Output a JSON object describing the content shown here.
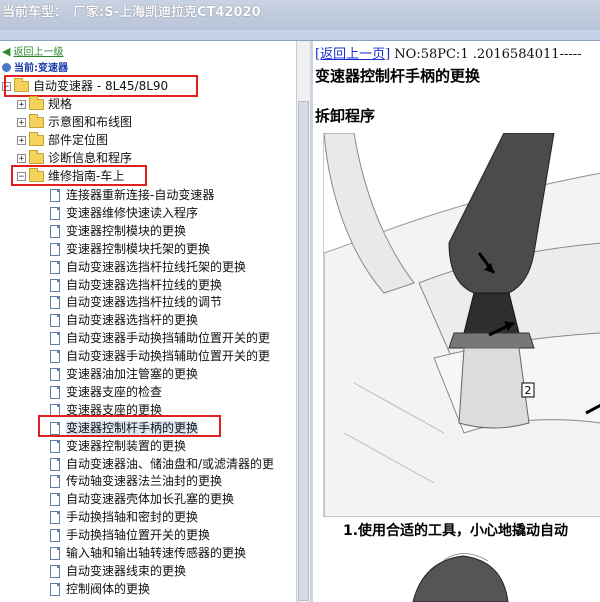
{
  "titlebar": {
    "label": "当前车型：",
    "brand": "厂家:S-上海凯迪拉克CT42020"
  },
  "tree": {
    "back_link": "返回上一级",
    "current": "当前:变速器",
    "root": "自动变速器 - 8L45/8L90",
    "folders": [
      "规格",
      "示意图和布线图",
      "部件定位图",
      "诊断信息和程序"
    ],
    "open_folder": "维修指南-车上",
    "docs": [
      "连接器重新连接-自动变速器",
      "变速器维修快速读入程序",
      "变速器控制模块的更换",
      "变速器控制模块托架的更换",
      "自动变速器选挡杆拉线托架的更换",
      "自动变速器选挡杆拉线的更换",
      "自动变速器选挡杆拉线的调节",
      "自动变速器选挡杆的更换",
      "自动变速器手动换挡辅助位置开关的更",
      "自动变速器手动换挡辅助位置开关的更",
      "变速器油加注管塞的更换",
      "变速器支座的检查",
      "变速器支座的更换",
      "变速器控制杆手柄的更换",
      "变速器控制装置的更换",
      "自动变速器油、储油盘和/或滤清器的更",
      "传动轴变速器法兰油封的更换",
      "自动变速器壳体加长孔塞的更换",
      "手动换挡轴和密封的更换",
      "手动换挡轴位置开关的更换",
      "输入轴和输出轴转速传感器的更换",
      "自动变速器线束的更换",
      "控制阀体的更换"
    ]
  },
  "content": {
    "back_link": "[返回上一页]",
    "doc_no": " NO:58PC:1 .2016584011-----",
    "title": "变速器控制杆手柄的更换",
    "section": "拆卸程序",
    "callout": "2",
    "step1": "1.使用合适的工具，小心地撬动自动"
  }
}
